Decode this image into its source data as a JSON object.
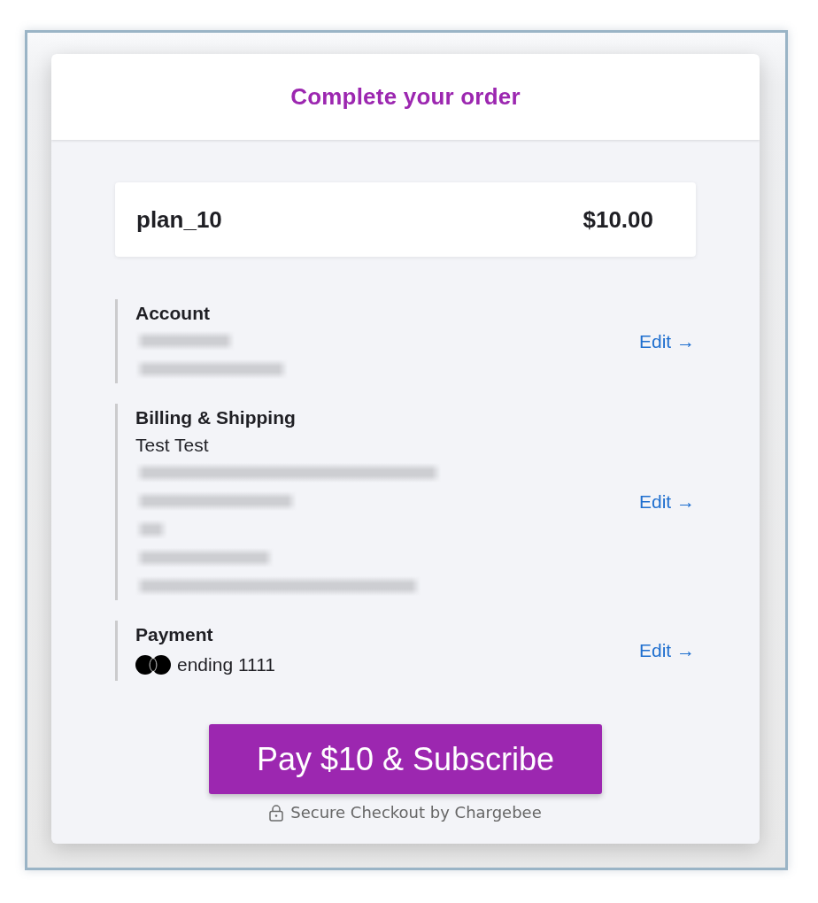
{
  "header": {
    "title": "Complete your order"
  },
  "summary": {
    "plan": "plan_10",
    "price": "$10.00"
  },
  "sections": [
    {
      "heading": "Account",
      "lines": [
        {
          "kind": "blurred"
        },
        {
          "kind": "blurred"
        }
      ],
      "edit_link": "Edit →"
    },
    {
      "heading": "Billing & Shipping",
      "lines": [
        {
          "kind": "text",
          "text": "Test Test"
        },
        {
          "kind": "blurred"
        },
        {
          "kind": "blurred"
        },
        {
          "kind": "blurred"
        },
        {
          "kind": "blurred"
        },
        {
          "kind": "blurred"
        }
      ],
      "edit_link": "Edit →"
    },
    {
      "heading": "Payment",
      "lines": [
        {
          "kind": "card",
          "text": "ending 1111"
        }
      ],
      "edit_link": "Edit →"
    }
  ],
  "pay_button": {
    "label": "Pay $10 & Subscribe"
  },
  "footer": {
    "text": "Secure Checkout by Chargebee"
  }
}
